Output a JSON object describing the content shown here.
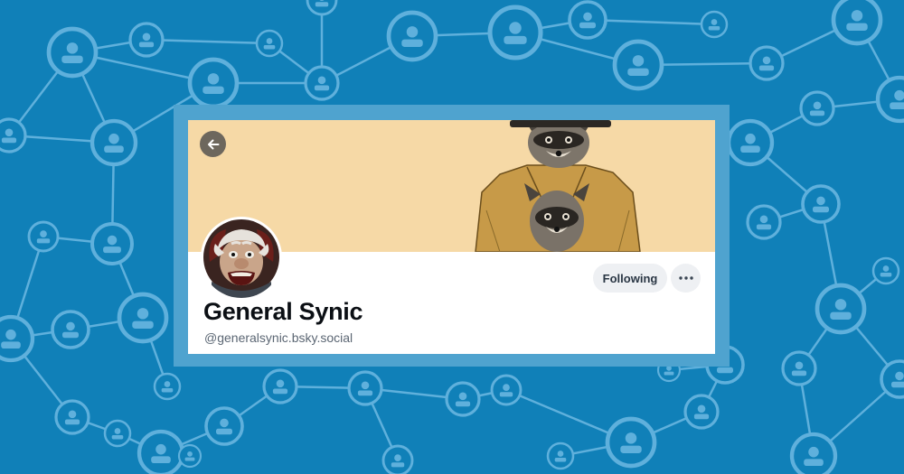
{
  "background": {
    "color": "#1080b8",
    "node_color": "#5fb0dc",
    "icon_name": "user-node-icon"
  },
  "profile": {
    "display_name": "General Synic",
    "handle": "@generalsynic.bsky.social",
    "follow_button_label": "Following",
    "more_button_icon": "more-options-icon",
    "back_button_icon": "arrow-left-icon",
    "banner_color": "#f6d9a6"
  }
}
